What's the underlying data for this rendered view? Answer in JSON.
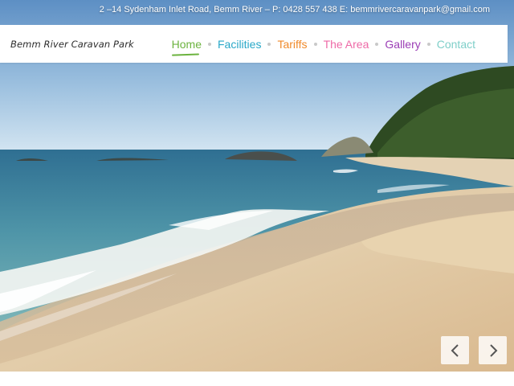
{
  "contact_bar": {
    "text": "2 –14 Sydenham Inlet Road, Bemm River – P: 0428 557 438 E: bemmriver​caravanpark@gmail.com"
  },
  "header": {
    "logo_text": "Bemm River Caravan Park"
  },
  "nav": {
    "items": [
      {
        "label": "Home",
        "color": "#6cb33f",
        "active": true
      },
      {
        "label": "Facilities",
        "color": "#29a8c8"
      },
      {
        "label": "Tariffs",
        "color": "#f08a2a"
      },
      {
        "label": "The Area",
        "color": "#ee6aa7"
      },
      {
        "label": "Gallery",
        "color": "#9b3db5"
      },
      {
        "label": "Contact",
        "color": "#7fcfc9"
      }
    ]
  },
  "slider": {
    "prev_icon": "chevron-left-icon",
    "next_icon": "chevron-right-icon"
  }
}
